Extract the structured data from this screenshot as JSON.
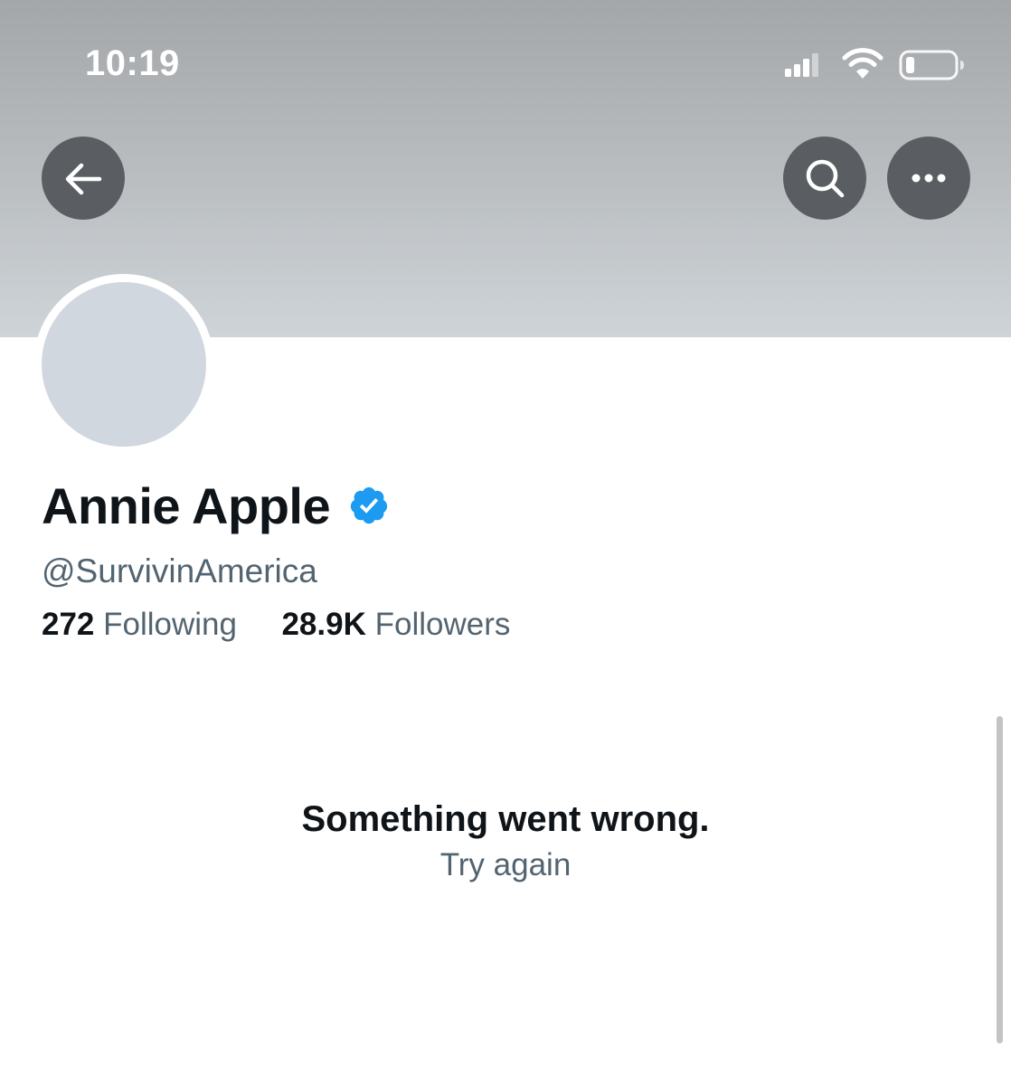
{
  "status_bar": {
    "time": "10:19",
    "icons": [
      "cellular-signal-icon",
      "wifi-icon",
      "battery-icon"
    ]
  },
  "header": {
    "back_icon": "arrow-left-icon",
    "search_icon": "search-icon",
    "more_icon": "more-horizontal-icon"
  },
  "profile": {
    "display_name": "Annie Apple",
    "verified": true,
    "handle": "@SurvivinAmerica",
    "following_count": "272",
    "following_label": "Following",
    "followers_count": "28.9K",
    "followers_label": "Followers"
  },
  "error": {
    "message": "Something went wrong.",
    "retry_label": "Try again"
  },
  "colors": {
    "text_primary": "#0f1419",
    "text_secondary": "#536471",
    "verified_blue": "#1d9bf0",
    "button_bg": "#5a5e62"
  }
}
